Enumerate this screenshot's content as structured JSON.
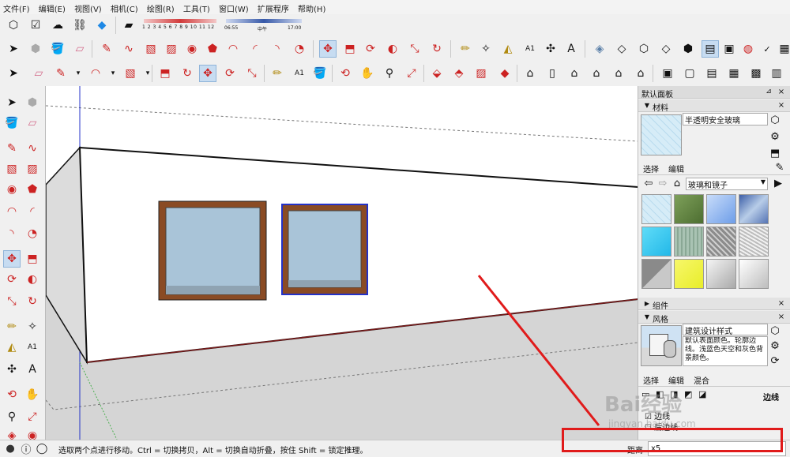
{
  "menu": [
    "文件(F)",
    "编辑(E)",
    "视图(V)",
    "相机(C)",
    "绘图(R)",
    "工具(T)",
    "窗口(W)",
    "扩展程序",
    "帮助(H)"
  ],
  "shadow": {
    "months": [
      "1",
      "2",
      "3",
      "4",
      "5",
      "6",
      "7",
      "8",
      "9",
      "10",
      "11",
      "12"
    ],
    "time_start": "06:55",
    "time_mid": "中午",
    "time_end": "17:00"
  },
  "panel": {
    "title": "默认面板",
    "materials_header": "材料",
    "material_name": "半透明安全玻璃",
    "tab_select": "选择",
    "tab_edit": "编辑",
    "library": "玻璃和镜子",
    "components_header": "组件",
    "styles_header": "风格",
    "style_name": "建筑设计样式",
    "style_desc": "默认表面颜色。轮廓边线。浅蓝色天空和灰色背景颜色。",
    "style_tab_select": "选择",
    "style_tab_edit": "编辑",
    "style_tab_mix": "混合",
    "edges_label": "边线",
    "edge_option1": "边线",
    "edge_option2": "后边线",
    "colors": {
      "swatches": [
        "#cfe6f2",
        "#5e7f3d",
        "#8ab4f0",
        "#6e8fc6",
        "#3fcdf2",
        "#9bb7a6",
        "#8c8c8c",
        "#bcbcbc",
        "#8a8a8a",
        "#e8ed2a",
        "#c8c8c8",
        "#e6e6e6"
      ]
    }
  },
  "status": {
    "message": "选取两个点进行移动。Ctrl = 切换拷贝，Alt = 切换自动折叠，按住 Shift = 锁定推理。",
    "measure_label": "距离",
    "measure_value": "x5"
  },
  "watermark": {
    "text1": "Bai经验",
    "text2": "jingyan.baidu.com"
  },
  "accent": "#e01b1b"
}
